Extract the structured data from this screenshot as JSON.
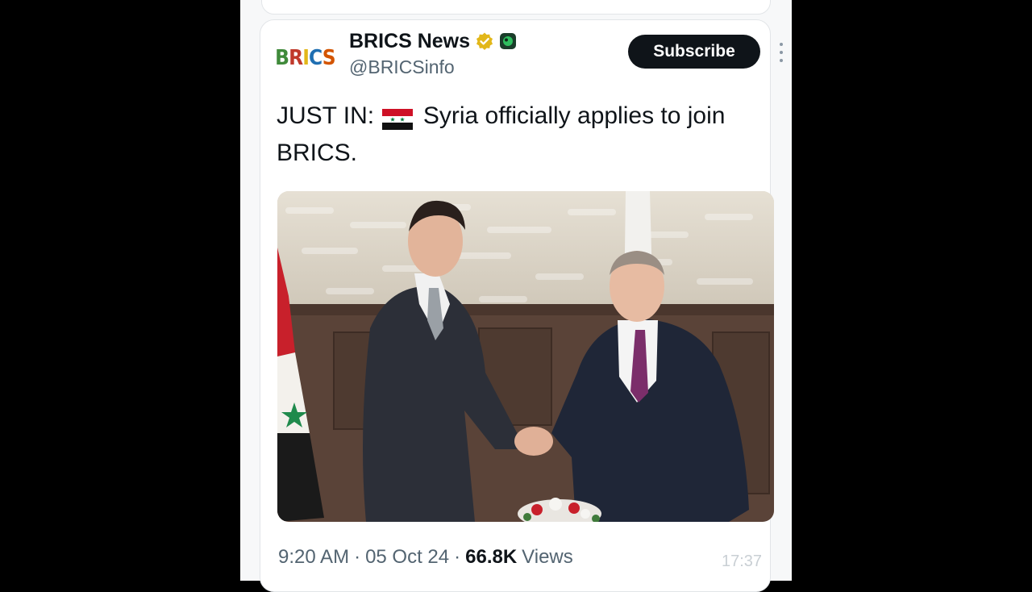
{
  "colors": {
    "background": "#000000",
    "card": "#ffffff",
    "text_primary": "#0f1419",
    "text_secondary": "#536471",
    "subscribe_bg": "#0f1419",
    "verified_gold": "#e2b719"
  },
  "post": {
    "avatar_text": "BRICS",
    "display_name": "BRICS News",
    "handle": "@BRICSinfo",
    "subscribe_label": "Subscribe",
    "icons": {
      "verified": "verified-gold-badge-icon",
      "affiliate": "affiliate-badge-icon",
      "more": "more-options-icon",
      "flag": "syria-flag-icon"
    },
    "text_before_flag": "JUST IN:",
    "text_after_flag": "Syria officially applies to join BRICS.",
    "image": {
      "subject": "photo-two-men-handshake"
    },
    "time": "9:20 AM",
    "separator": "·",
    "date": "05 Oct 24",
    "views_count": "66.8K",
    "views_label": "Views",
    "screenshot_time": "17:37"
  }
}
